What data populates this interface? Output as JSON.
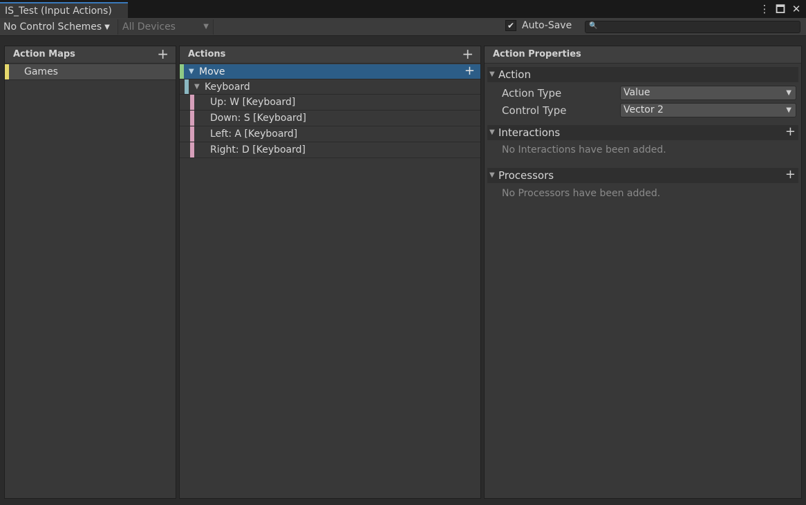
{
  "window": {
    "tab_title": "IS_Test (Input Actions)",
    "icons": [
      "kebab-menu-icon",
      "maximize-icon",
      "close-icon"
    ]
  },
  "toolbar": {
    "control_schemes": "No Control Schemes",
    "devices": "All Devices",
    "autosave_label": "Auto-Save",
    "autosave_checked": true,
    "search_value": ""
  },
  "action_maps": {
    "header": "Action Maps",
    "items": [
      {
        "label": "Games",
        "color": "#e5d86c"
      }
    ]
  },
  "actions": {
    "header": "Actions",
    "items": [
      {
        "label": "Move",
        "selected": true,
        "color": "#8fca85"
      },
      {
        "label": "Keyboard",
        "color": "#8bb8c2"
      },
      {
        "label": "Up: W [Keyboard]",
        "color": "#d69fba"
      },
      {
        "label": "Down: S [Keyboard]",
        "color": "#d69fba"
      },
      {
        "label": "Left: A [Keyboard]",
        "color": "#d69fba"
      },
      {
        "label": "Right: D [Keyboard]",
        "color": "#d69fba"
      }
    ]
  },
  "properties": {
    "header": "Action Properties",
    "action_section": "Action",
    "action_type_label": "Action Type",
    "action_type_value": "Value",
    "control_type_label": "Control Type",
    "control_type_value": "Vector 2",
    "interactions_section": "Interactions",
    "interactions_empty": "No Interactions have been added.",
    "processors_section": "Processors",
    "processors_empty": "No Processors have been added."
  }
}
